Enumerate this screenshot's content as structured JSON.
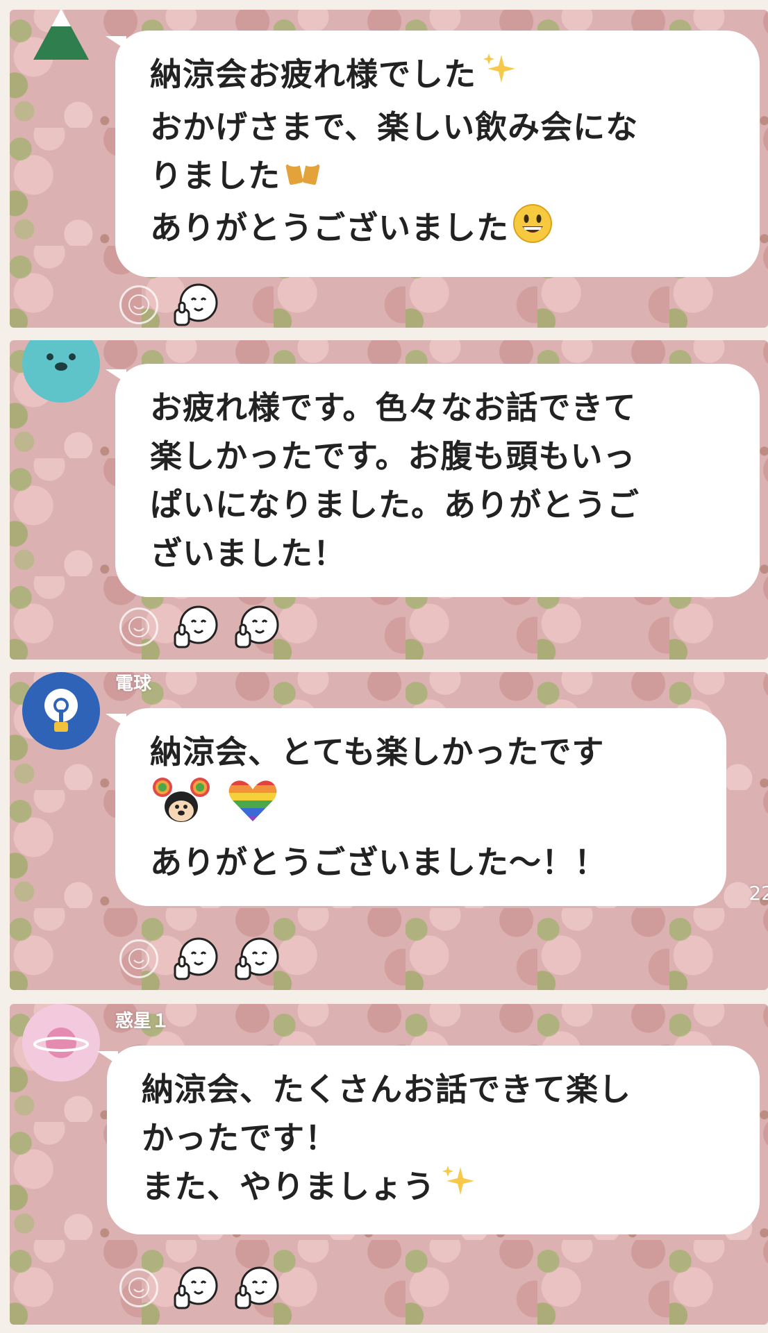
{
  "colors": {
    "bubble": "#ffffff",
    "text": "#222222",
    "background": "#dcb1b1",
    "avatar_bear": "#5fc4c9",
    "avatar_bulb": "#2e63b8",
    "avatar_planet": "#f3c9de"
  },
  "messages": [
    {
      "sender": "",
      "avatar_icon": "tree-icon",
      "lines": [
        "納涼会お疲れ様でした",
        "おかげさまで、楽しい飲み会にな",
        "りました",
        "ありがとうございました"
      ],
      "emojis": [
        "sparkles-emoji",
        "beer-mugs-emoji",
        "smiling-face-emoji"
      ],
      "reactions": [
        "thumbs-up-face-stamp"
      ]
    },
    {
      "sender": "",
      "avatar_icon": "bear-icon",
      "lines": [
        "お疲れ様です。色々なお話できて",
        "楽しかったです。お腹も頭もいっ",
        "ぱいになりました。ありがとうご",
        "ざいました！"
      ],
      "emojis": [],
      "reactions": [
        "thumbs-up-face-stamp",
        "thumbs-up-face-stamp"
      ]
    },
    {
      "sender": "電球",
      "avatar_icon": "lightbulb-icon",
      "lines": [
        "納涼会、とても楽しかったです",
        "",
        "ありがとうございました〜！！"
      ],
      "emojis": [
        "rainbow-mouse-emoji",
        "rainbow-heart-emoji"
      ],
      "reactions": [
        "thumbs-up-face-stamp",
        "thumbs-up-face-stamp"
      ],
      "time": "22"
    },
    {
      "sender": "惑星１",
      "avatar_icon": "planet-icon",
      "lines": [
        "納涼会、たくさんお話できて楽し",
        "かったです！",
        "また、やりましょう"
      ],
      "emojis": [
        "sparkles-emoji"
      ],
      "reactions": [
        "thumbs-up-face-stamp",
        "thumbs-up-face-stamp"
      ]
    }
  ]
}
